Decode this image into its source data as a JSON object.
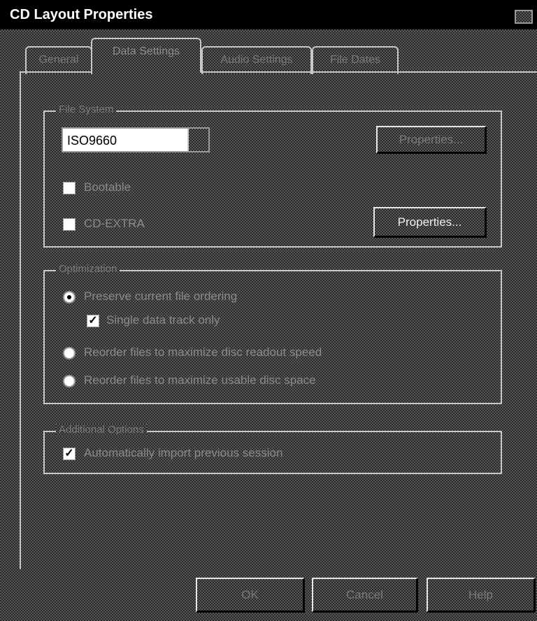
{
  "window": {
    "title": "CD Layout Properties"
  },
  "tabs": [
    {
      "label": "General"
    },
    {
      "label": "Data Settings",
      "active": true
    },
    {
      "label": "Audio Settings"
    },
    {
      "label": "File Dates"
    }
  ],
  "file_system": {
    "legend": "File System",
    "selected": "ISO9660",
    "properties_button": "Properties...",
    "bootable_label": "Bootable",
    "bootable_checked": false,
    "cd_extra_label": "CD-EXTRA",
    "cd_extra_checked": false,
    "cd_extra_properties_button": "Properties..."
  },
  "optimization": {
    "legend": "Optimization",
    "options": [
      {
        "label": "Preserve current file ordering",
        "selected": true
      },
      {
        "label": "Reorder files to maximize disc readout speed",
        "selected": false
      },
      {
        "label": "Reorder files to maximize usable disc space",
        "selected": false
      }
    ],
    "single_track_label": "Single data track only",
    "single_track_checked": true
  },
  "additional": {
    "legend": "Additional Options",
    "import_label": "Automatically import previous session",
    "import_checked": true
  },
  "footer": {
    "ok": "OK",
    "cancel": "Cancel",
    "help": "Help"
  }
}
